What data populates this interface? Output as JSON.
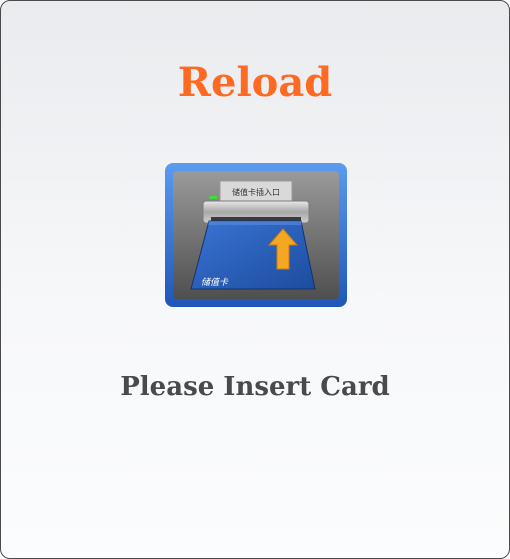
{
  "screen": {
    "title": "Reload",
    "prompt": "Please Insert Card"
  },
  "illustration": {
    "slot_label": "储值卡插入口",
    "card_label": "储值卡",
    "icons": [
      "card-reader-icon",
      "card-icon",
      "insert-arrow-icon",
      "indicator-light-icon"
    ]
  },
  "colors": {
    "title": "#ff6a22",
    "prompt": "#4a4a4a",
    "frame": "#2f6fd6",
    "card": "#2b5fb8",
    "arrow": "#f5a623",
    "indicator": "#3ddc3d"
  }
}
